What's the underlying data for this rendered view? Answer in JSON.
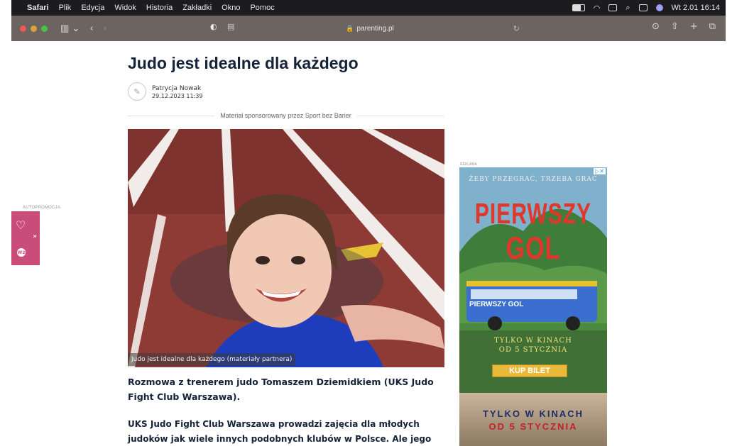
{
  "menubar": {
    "app": "Safari",
    "items": [
      "Plik",
      "Edycja",
      "Widok",
      "Historia",
      "Zakładki",
      "Okno",
      "Pomoc"
    ],
    "clock": "Wt 2.01  16:14"
  },
  "browser": {
    "url": "parenting.pl"
  },
  "article": {
    "title": "Judo jest idealne dla każdego",
    "author": "Patrycja Nowak",
    "date": "29.12.2023 11:39",
    "sponsor": "Materiał sponsorowany przez Sport bez Barier",
    "image_caption": "Judo jest idealne dla każdego (materiały partnera)",
    "lead": "Rozmowa z trenerem judo Tomaszem Dziemidkiem (UKS Judo Fight Club Warszawa).",
    "paragraph": "UKS Judo Fight Club Warszawa prowadzi zajęcia dla młodych judoków jak wiele innych podobnych klubów w Polsce. Ale jego"
  },
  "autopromo": {
    "label": "AUTOPROMOCJA",
    "badge": "W2"
  },
  "ad": {
    "label": "REKLAMA",
    "tagline": "ŻEBY PRZEGRAĆ, TRZEBA GRAĆ",
    "title_1": "PIERWSZY",
    "title_2": "GOL",
    "bus_text": "PIERWSZY GOL",
    "cinema_1": "TYLKO W KINACH",
    "cinema_2": "OD 5 STYCZNIA",
    "button": "KUP BILET",
    "bottom_1": "TYLKO W KINACH",
    "bottom_2": "OD 5 STYCZNIA"
  },
  "colors": {
    "menubar_bg": "#1c1c1e",
    "toolbar_bg": "#6b6461",
    "headline": "#14233a",
    "autopromo": "#c94d78",
    "track": "#8a3a35"
  }
}
